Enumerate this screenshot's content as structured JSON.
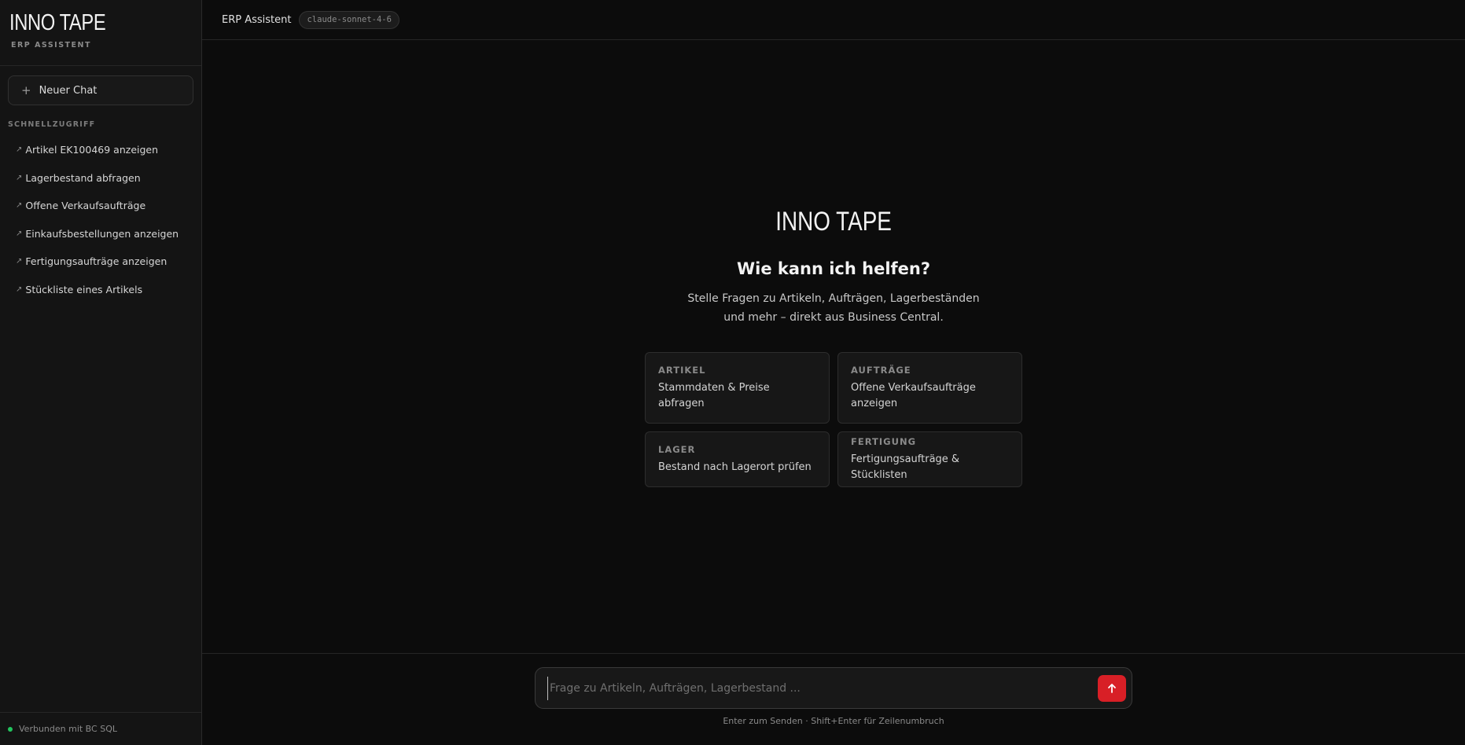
{
  "sidebar": {
    "brand_title": "INNO TAPE",
    "brand_subtitle": "ERP ASSISTENT",
    "new_chat_label": "Neuer Chat",
    "section_label": "SCHNELLZUGRIFF",
    "quick_items": [
      {
        "label": "Artikel EK100469 anzeigen"
      },
      {
        "label": "Lagerbestand abfragen"
      },
      {
        "label": "Offene Verkaufsaufträge"
      },
      {
        "label": "Einkaufsbestellungen anzeigen"
      },
      {
        "label": "Fertigungsaufträge anzeigen"
      },
      {
        "label": "Stückliste eines Artikels"
      }
    ],
    "status_text": "Verbunden mit BC SQL",
    "status_color": "#22c55e"
  },
  "topbar": {
    "title": "ERP Assistent",
    "model": "claude-sonnet-4-6"
  },
  "welcome": {
    "logo": "INNO TAPE",
    "heading": "Wie kann ich helfen?",
    "text": "Stelle Fragen zu Artikeln, Aufträgen, Lagerbeständen und mehr – direkt aus Business Central.",
    "cards": [
      {
        "label": "ARTIKEL",
        "text": "Stammdaten & Preise abfragen"
      },
      {
        "label": "AUFTRÄGE",
        "text": "Offene Verkaufsaufträge anzeigen"
      },
      {
        "label": "LAGER",
        "text": "Bestand nach Lagerort prüfen"
      },
      {
        "label": "FERTIGUNG",
        "text": "Fertigungsaufträge & Stücklisten"
      }
    ]
  },
  "composer": {
    "placeholder": "Frage zu Artikeln, Aufträgen, Lagerbestand ...",
    "value": "",
    "hint": "Enter zum Senden · Shift+Enter für Zeilenumbruch",
    "send_icon": "arrow-up-icon",
    "accent_color": "#d81f26"
  }
}
